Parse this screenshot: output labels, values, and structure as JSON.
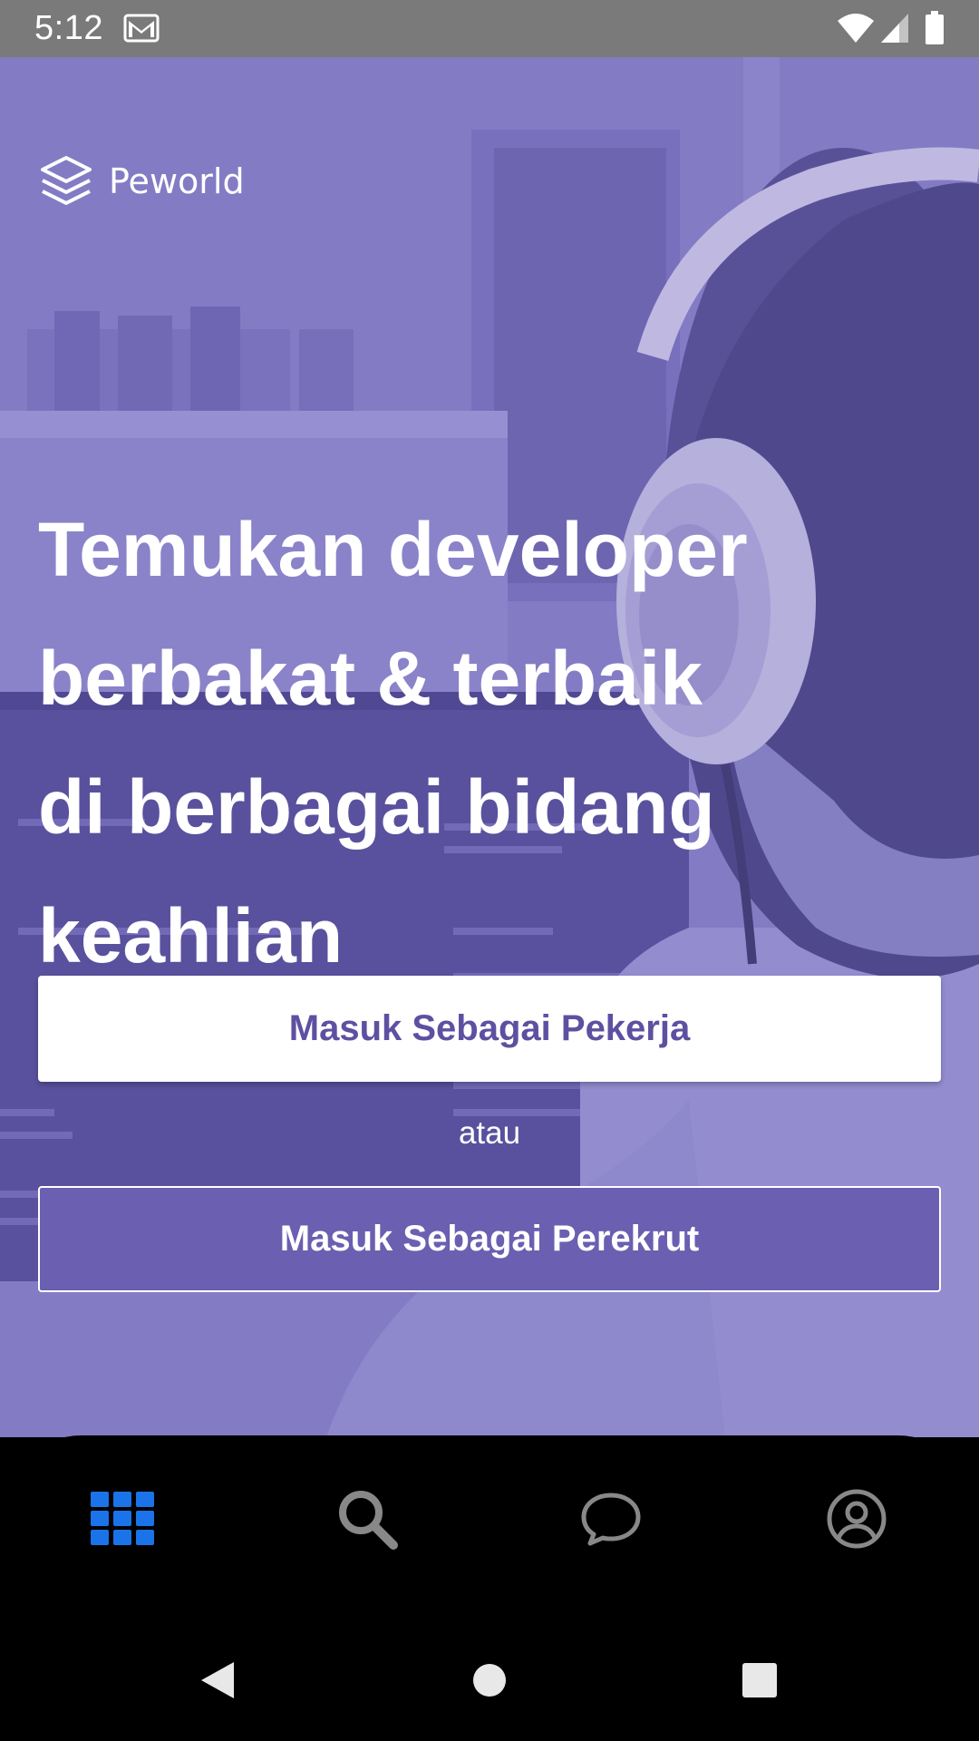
{
  "status_bar": {
    "time": "5:12",
    "icons": [
      "gmail-icon",
      "wifi-icon",
      "signal-icon",
      "battery-icon"
    ]
  },
  "brand": {
    "name": "Peworld",
    "logo_icon": "layers-icon"
  },
  "hero": {
    "headline_lines": [
      "Temukan developer",
      "berbakat & terbaik",
      "di berbagai bidang",
      "keahlian"
    ]
  },
  "actions": {
    "worker_button": "Masuk Sebagai Pekerja",
    "separator": "atau",
    "recruiter_button": "Masuk Sebagai Perekrut"
  },
  "bottom_nav": {
    "items": [
      {
        "icon": "grid-icon",
        "active": true
      },
      {
        "icon": "search-icon",
        "active": false
      },
      {
        "icon": "chat-icon",
        "active": false
      },
      {
        "icon": "profile-icon",
        "active": false
      }
    ],
    "active_color": "#1a73e8",
    "inactive_color": "#888888"
  },
  "colors": {
    "brand_purple": "#5e50a1",
    "hero_overlay": "#8a83c2",
    "recruiter_button": "#6a5fb0",
    "status_bar": "#7a7a7a"
  }
}
